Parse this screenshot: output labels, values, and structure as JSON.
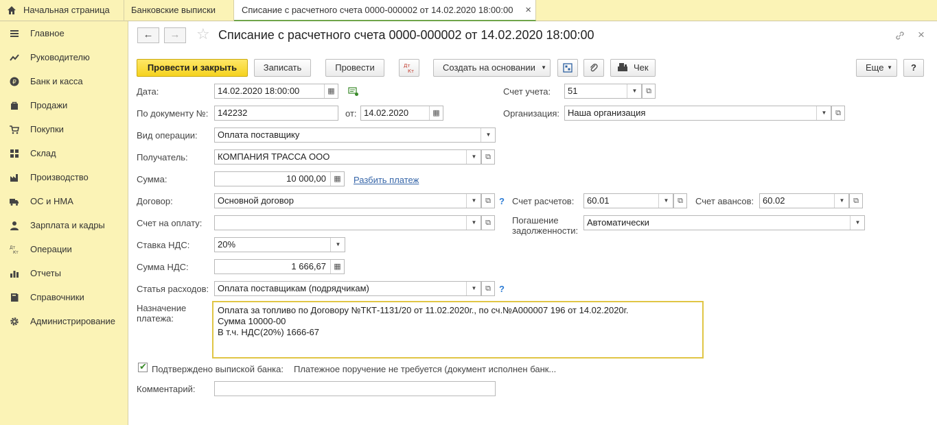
{
  "tabs": {
    "home": "Начальная страница",
    "bank": "Банковские выписки",
    "active": "Списание с расчетного счета 0000-000002 от 14.02.2020 18:00:00",
    "close": "×"
  },
  "sidebar": {
    "items": [
      {
        "label": "Главное",
        "icon": "menu-icon"
      },
      {
        "label": "Руководителю",
        "icon": "chart-line-icon"
      },
      {
        "label": "Банк и касса",
        "icon": "ruble-icon"
      },
      {
        "label": "Продажи",
        "icon": "bag-icon"
      },
      {
        "label": "Покупки",
        "icon": "cart-icon"
      },
      {
        "label": "Склад",
        "icon": "grid-icon"
      },
      {
        "label": "Производство",
        "icon": "factory-icon"
      },
      {
        "label": "ОС и НМА",
        "icon": "truck-icon"
      },
      {
        "label": "Зарплата и кадры",
        "icon": "person-icon"
      },
      {
        "label": "Операции",
        "icon": "dt-kt-icon"
      },
      {
        "label": "Отчеты",
        "icon": "bar-chart-icon"
      },
      {
        "label": "Справочники",
        "icon": "book-icon"
      },
      {
        "label": "Администрирование",
        "icon": "gear-icon"
      }
    ]
  },
  "header": {
    "title": "Списание с расчетного счета 0000-000002 от 14.02.2020 18:00:00",
    "back": "←",
    "forward": "→",
    "star": "☆",
    "link_icon": "🔗",
    "close_icon": "×"
  },
  "toolbar": {
    "post_close": "Провести и закрыть",
    "save": "Записать",
    "post": "Провести",
    "dtkt": "Дт Кт",
    "create_based": "Создать на основании",
    "check": "Чек",
    "more": "Еще",
    "help": "?"
  },
  "form": {
    "date_label": "Дата:",
    "date_value": "14.02.2020 18:00:00",
    "doc_no_label": "По документу №:",
    "doc_no_value": "142232",
    "from_label": "от:",
    "from_value": "14.02.2020",
    "op_type_label": "Вид операции:",
    "op_type_value": "Оплата поставщику",
    "recipient_label": "Получатель:",
    "recipient_value": "КОМПАНИЯ ТРАССА ООО",
    "sum_label": "Сумма:",
    "sum_value": "10 000,00",
    "split_link": "Разбить платеж",
    "contract_label": "Договор:",
    "contract_value": "Основной договор",
    "invoice_label": "Счет на оплату:",
    "invoice_value": "",
    "vat_rate_label": "Ставка НДС:",
    "vat_rate_value": "20%",
    "vat_sum_label": "Сумма НДС:",
    "vat_sum_value": "1 666,67",
    "expense_label": "Статья расходов:",
    "expense_value": "Оплата поставщикам (подрядчикам)",
    "purpose_label_1": "Назначение",
    "purpose_label_2": "платежа:",
    "purpose_line_1": "Оплата за топливо по Договору №ТКТ-1131/20 от 11.02.2020г., по сч.№А000007 196 от 14.02.2020г.",
    "purpose_line_2": "Сумма 10000-00",
    "purpose_line_3": "В т.ч. НДС(20%) 1666-67",
    "confirmed_label": "Подтверждено выпиской банка:",
    "confirmed_note": "Платежное поручение не требуется (документ исполнен банк...",
    "comment_label": "Комментарий:",
    "comment_value": "",
    "account_label": "Счет учета:",
    "account_value": "51",
    "org_label": "Организация:",
    "org_value": "Наша организация",
    "settle_acc_label": "Счет расчетов:",
    "settle_acc_value": "60.01",
    "advance_acc_label": "Счет авансов:",
    "advance_acc_value": "60.02",
    "debt_label_1": "Погашение",
    "debt_label_2": "задолженности:",
    "debt_value": "Автоматически",
    "help_mark": "?"
  },
  "colors": {
    "panel_yellow": "#fbf3b6",
    "primary_button": "#f5d21e",
    "focus_border": "#e0c544",
    "link": "#3565a8"
  }
}
